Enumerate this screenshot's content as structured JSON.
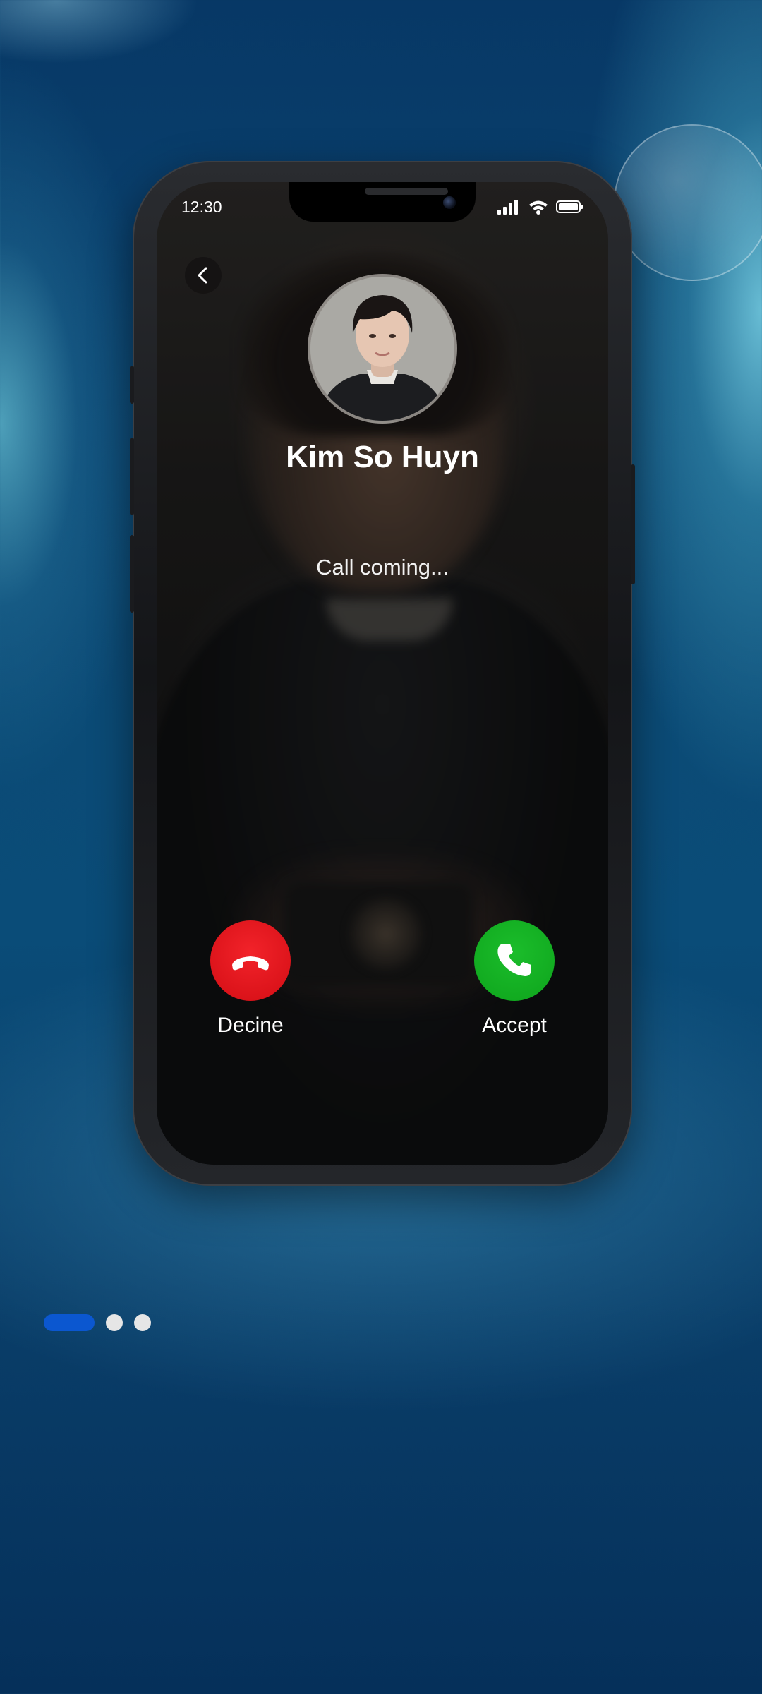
{
  "status_bar": {
    "time": "12:30",
    "icons": [
      "signal-icon",
      "wifi-icon",
      "battery-icon"
    ]
  },
  "header": {
    "back_icon": "chevron-left-icon"
  },
  "caller": {
    "name": "Kim So Huyn",
    "status": "Call coming..."
  },
  "actions": {
    "decline": {
      "label": "Decine",
      "icon": "phone-hangup-icon",
      "color": "#E30B14"
    },
    "accept": {
      "label": "Accept",
      "icon": "phone-icon",
      "color": "#12B022"
    }
  },
  "pagination": {
    "total": 3,
    "current": 1,
    "active_color": "#0B57D0",
    "inactive_color": "#E6E6E6"
  },
  "colors": {
    "background": "#0A3F6A"
  }
}
